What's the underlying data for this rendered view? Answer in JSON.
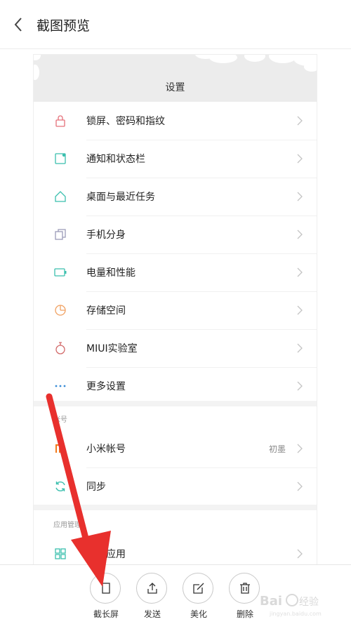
{
  "header": {
    "title": "截图预览"
  },
  "preview": {
    "title": "设置",
    "rows": [
      {
        "label": "锁屏、密码和指纹",
        "icon": "lock-icon",
        "color": "#e5707a"
      },
      {
        "label": "通知和状态栏",
        "icon": "notification-icon",
        "color": "#3bbfae"
      },
      {
        "label": "桌面与最近任务",
        "icon": "home-icon",
        "color": "#3bbfae"
      },
      {
        "label": "手机分身",
        "icon": "clone-icon",
        "color": "#9b9bb8"
      },
      {
        "label": "电量和性能",
        "icon": "battery-icon",
        "color": "#3bbfae"
      },
      {
        "label": "存储空间",
        "icon": "storage-icon",
        "color": "#f0a060"
      },
      {
        "label": "MIUI实验室",
        "icon": "flask-icon",
        "color": "#d26a6a"
      },
      {
        "label": "更多设置",
        "icon": "more-icon",
        "color": "#3a8dd6"
      }
    ],
    "account_section": "帐号",
    "account_rows": [
      {
        "label": "小米帐号",
        "value": "初墨",
        "icon": "mi-icon",
        "color": "#f27a1a"
      },
      {
        "label": "同步",
        "icon": "sync-icon",
        "color": "#3bbfae"
      }
    ],
    "apps_section": "应用管理",
    "apps_rows": [
      {
        "label": "系统应用",
        "icon": "apps-icon",
        "color": "#3bbfae"
      }
    ]
  },
  "toolbar": {
    "long_screenshot": "截长屏",
    "send": "发送",
    "beautify": "美化",
    "delete": "删除"
  },
  "colors": {
    "arrow": "#e8302d",
    "chevron": "#c4c4c4"
  }
}
